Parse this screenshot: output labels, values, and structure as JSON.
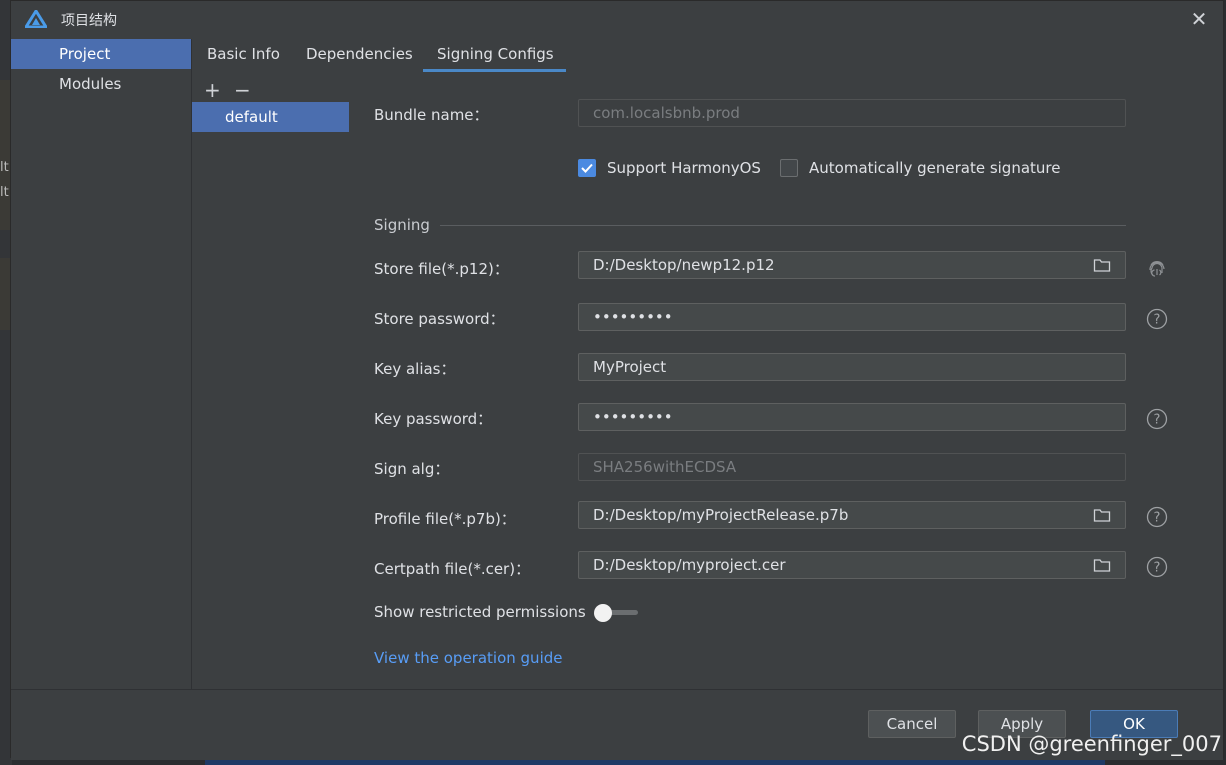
{
  "window": {
    "title": "项目结构"
  },
  "nav": {
    "items": [
      "Project",
      "Modules"
    ],
    "selected": "Project"
  },
  "tabs": [
    "Basic Info",
    "Dependencies",
    "Signing Configs"
  ],
  "active_tab": "Signing Configs",
  "configs": {
    "add": "+",
    "remove": "−",
    "items": [
      "default"
    ]
  },
  "form": {
    "bundle_name_label": "Bundle name：",
    "bundle_name_value": "com.localsbnb.prod",
    "support_harmony_label": "Support HarmonyOS",
    "support_harmony_checked": true,
    "auto_sign_label": "Automatically generate signature",
    "auto_sign_checked": false,
    "signing_section": "Signing",
    "store_file_label": "Store file(*.p12)：",
    "store_file_value": "D:/Desktop/newp12.p12",
    "store_password_label": "Store password：",
    "store_password_value": "•••••••••",
    "key_alias_label": "Key alias：",
    "key_alias_value": "MyProject",
    "key_password_label": "Key password：",
    "key_password_value": "•••••••••",
    "sign_alg_label": "Sign alg：",
    "sign_alg_value": "SHA256withECDSA",
    "profile_file_label": "Profile file(*.p7b)：",
    "profile_file_value": "D:/Desktop/myProjectRelease.p7b",
    "certpath_file_label": "Certpath file(*.cer)：",
    "certpath_file_value": "D:/Desktop/myproject.cer",
    "restricted_label": "Show restricted permissions",
    "restricted_on": false,
    "guide_link": "View the operation guide"
  },
  "buttons": {
    "cancel": "Cancel",
    "apply": "Apply",
    "ok": "OK"
  },
  "watermark": "CSDN @greenfinger_007",
  "background_text": [
    "lt",
    "lt"
  ],
  "colors": {
    "selection": "#4b6eaf",
    "accent": "#4a88c7",
    "link": "#589df6",
    "primary_button": "#365880"
  }
}
